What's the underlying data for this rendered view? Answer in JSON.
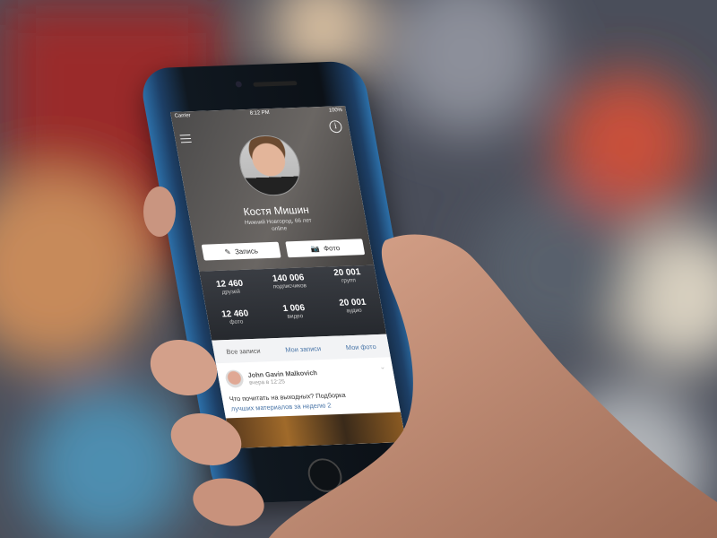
{
  "status_bar": {
    "carrier": "Carrier",
    "time": "8:12 PM",
    "battery": "100%"
  },
  "profile": {
    "name": "Костя Мишин",
    "location": "Нижний Новгород, 66 лет",
    "status": "online"
  },
  "actions": {
    "post_label": "Запись",
    "photo_label": "Фото"
  },
  "stats": [
    {
      "value": "12 460",
      "label": "друзей"
    },
    {
      "value": "140 006",
      "label": "подписчиков"
    },
    {
      "value": "20 001",
      "label": "групп"
    },
    {
      "value": "12 460",
      "label": "фото"
    },
    {
      "value": "1 006",
      "label": "видео"
    },
    {
      "value": "20 001",
      "label": "аудио"
    }
  ],
  "tabs": [
    {
      "label": "Все записи"
    },
    {
      "label": "Мои записи"
    },
    {
      "label": "Мои фото"
    }
  ],
  "post": {
    "author": "John Gavin Malkovich",
    "time": "вчера в 12:25",
    "text": "Что почитать на выходных? Подборка",
    "link": "лучших материалов за неделю 2"
  },
  "colors": {
    "accent": "#4a76a8"
  }
}
